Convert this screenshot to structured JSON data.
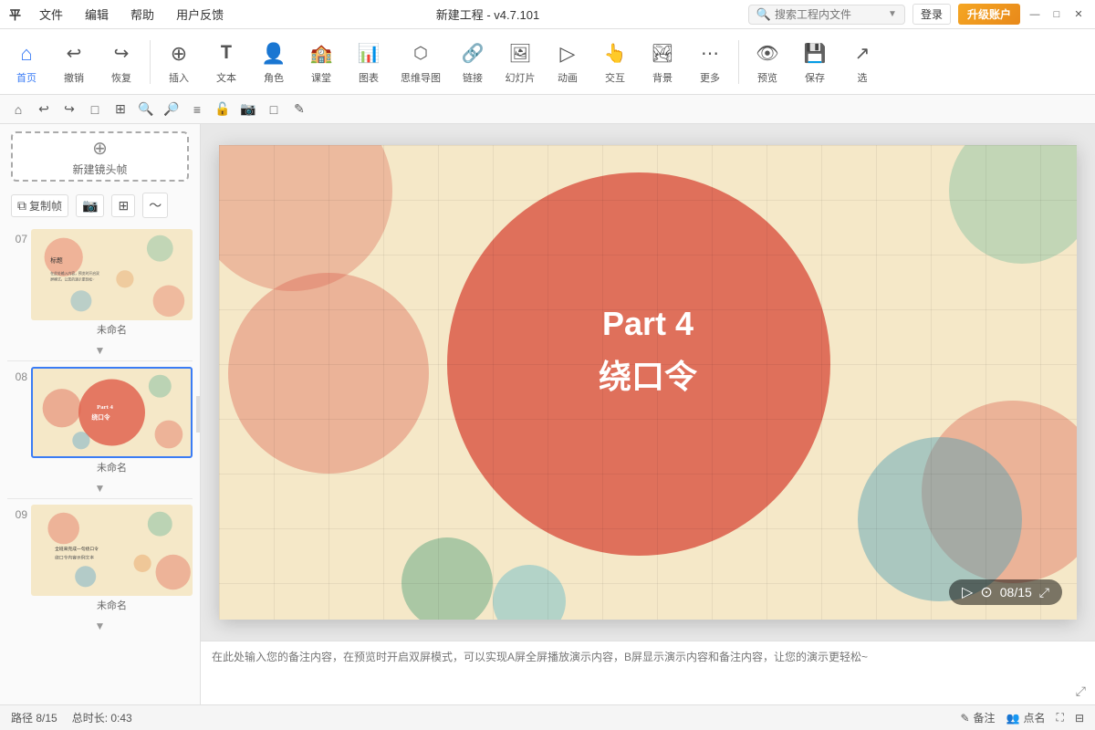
{
  "app": {
    "title": "新建工程 - v4.7.101",
    "platform": "平",
    "menu_items": [
      "文件",
      "编辑",
      "帮助",
      "用户反馈"
    ],
    "search_placeholder": "搜索工程内文件",
    "btn_login": "登录",
    "btn_upgrade": "升级账户",
    "win_buttons": [
      "—",
      "□",
      "×"
    ]
  },
  "toolbar": {
    "items": [
      {
        "id": "home",
        "label": "首页",
        "icon": "⌂"
      },
      {
        "id": "undo",
        "label": "撤销",
        "icon": "↩"
      },
      {
        "id": "redo",
        "label": "恢复",
        "icon": "↪"
      },
      {
        "id": "insert",
        "label": "插入",
        "icon": "⊕"
      },
      {
        "id": "text",
        "label": "文本",
        "icon": "▤"
      },
      {
        "id": "role",
        "label": "角色",
        "icon": "☺"
      },
      {
        "id": "class",
        "label": "课堂",
        "icon": "🏫"
      },
      {
        "id": "chart",
        "label": "图表",
        "icon": "📊"
      },
      {
        "id": "mindmap",
        "label": "思维导图",
        "icon": "🕸"
      },
      {
        "id": "link",
        "label": "链接",
        "icon": "🔗"
      },
      {
        "id": "slideshow",
        "label": "幻灯片",
        "icon": "🖼"
      },
      {
        "id": "animation",
        "label": "动画",
        "icon": "▷"
      },
      {
        "id": "interact",
        "label": "交互",
        "icon": "👆"
      },
      {
        "id": "background",
        "label": "背景",
        "icon": "🏞"
      },
      {
        "id": "more",
        "label": "更多",
        "icon": "•••"
      },
      {
        "id": "preview",
        "label": "预览",
        "icon": "👁"
      },
      {
        "id": "save",
        "label": "保存",
        "icon": "💾"
      },
      {
        "id": "select",
        "label": "选",
        "icon": "↗"
      }
    ]
  },
  "secondary_toolbar": {
    "buttons": [
      "⌂",
      "↩",
      "↪",
      "□",
      "⊞",
      "🔍+",
      "🔍-",
      "≡",
      "🔒",
      "📷",
      "□",
      "✎"
    ]
  },
  "sidebar": {
    "new_slide_label": "新建镜头帧",
    "slide_tools": [
      "复制帧",
      "📷",
      "⊞",
      "~"
    ],
    "slides": [
      {
        "num": "07",
        "label": "未命名",
        "active": false,
        "slide_num_display": "07"
      },
      {
        "num": "08",
        "label": "未命名",
        "active": true,
        "slide_num_display": "08"
      },
      {
        "num": "09",
        "label": "未命名",
        "active": false,
        "slide_num_display": "09"
      }
    ]
  },
  "canvas": {
    "slide_title_line1": "Part 4",
    "slide_title_line2": "绕口令",
    "counter": "08/15"
  },
  "notes": {
    "placeholder": "在此处输入您的备注内容，在预览时开启双屏模式，可以实现A屏全屏播放演示内容，B屏显示演示内容和备注内容，让您的演示更轻松~"
  },
  "status_bar": {
    "path": "路径 8/15",
    "duration": "总时长: 0:43",
    "annotation": "备注",
    "callname": "点名",
    "fullscreen_icon": "⛶",
    "collapse_icon": "⊟"
  }
}
